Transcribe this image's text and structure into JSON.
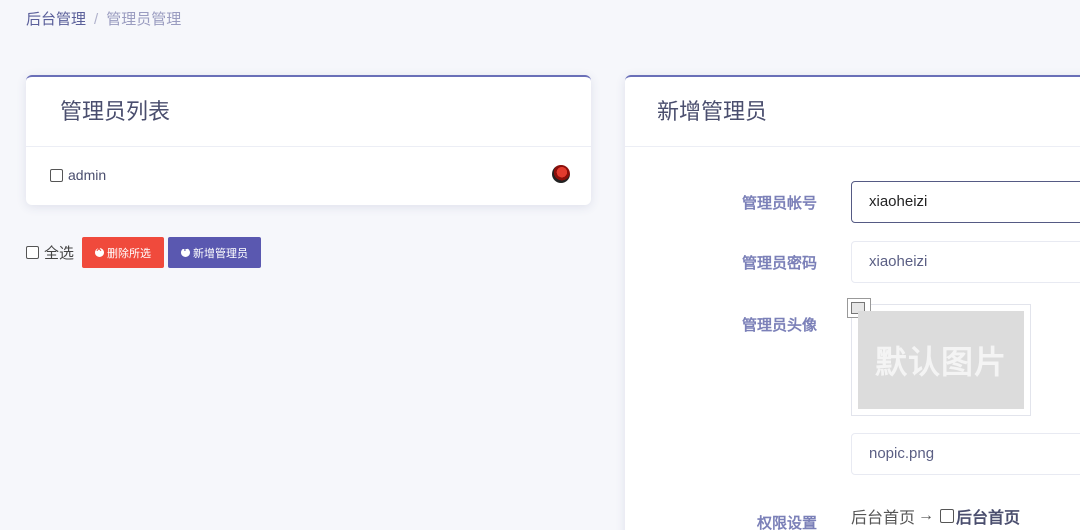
{
  "breadcrumb": {
    "home": "后台管理",
    "separator": "/",
    "current": "管理员管理"
  },
  "list_card": {
    "title": "管理员列表",
    "admins": [
      {
        "name": "admin"
      }
    ]
  },
  "bulk": {
    "select_all_label": "全选",
    "delete_label": "删除所选",
    "add_label": "新增管理员"
  },
  "form_card": {
    "title": "新增管理员",
    "account": {
      "label": "管理员帐号",
      "value": "xiaoheizi"
    },
    "password": {
      "label": "管理员密码",
      "value": "xiaoheizi"
    },
    "avatar": {
      "label": "管理员头像",
      "placeholder_text": "默认图片",
      "filename": "nopic.png"
    },
    "permissions": {
      "label": "权限设置",
      "parent": "后台首页",
      "arrow": "→",
      "child": "后台首页"
    }
  },
  "colors": {
    "accent": "#5a58b0",
    "danger": "#f04a3c",
    "label": "#7b80b8"
  }
}
